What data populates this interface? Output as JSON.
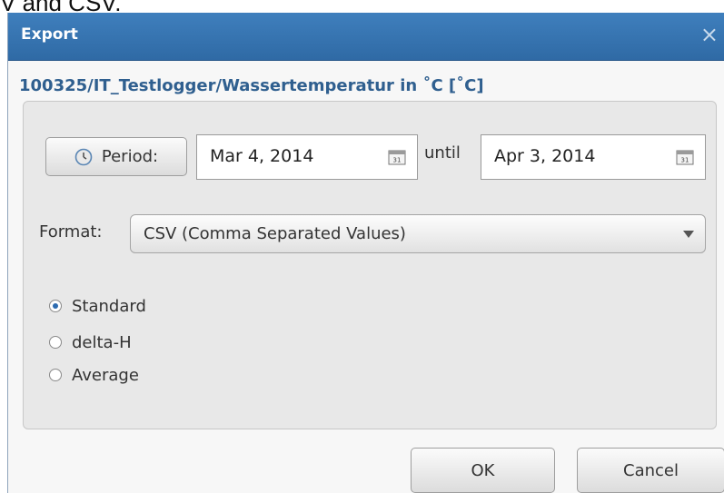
{
  "caption_fragment": "V and CSV.",
  "dialog": {
    "title": "Export",
    "close_glyph": "×",
    "subtitle": "100325/IT_Testlogger/Wassertemperatur in ˚C [˚C]"
  },
  "period": {
    "button_label": "Period:",
    "icon": "clock-icon",
    "from_value": "Mar 4, 2014",
    "until_label": "until",
    "to_value": "Apr 3, 2014",
    "calendar_icon": "calendar-icon",
    "calendar_icon_text": "31"
  },
  "format": {
    "label": "Format:",
    "selected": "CSV (Comma Separated Values)"
  },
  "mode_options": [
    {
      "label": "Standard",
      "checked": true
    },
    {
      "label": "delta-H",
      "checked": false
    },
    {
      "label": "Average",
      "checked": false
    }
  ],
  "buttons": {
    "ok": "OK",
    "cancel": "Cancel"
  },
  "colors": {
    "titlebar": "#3672af",
    "subtitle": "#2f5f8f",
    "panel": "#e8e8e8"
  }
}
